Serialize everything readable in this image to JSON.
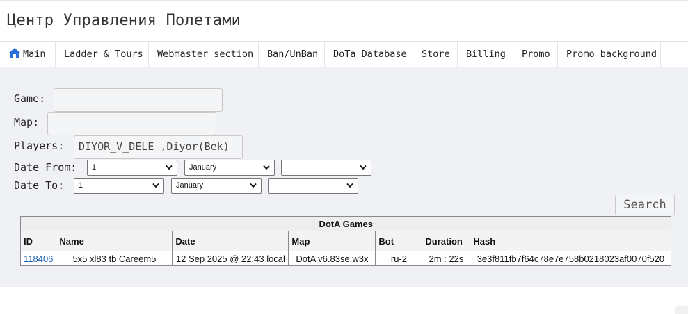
{
  "site": {
    "title": "Центр Управления Полетами"
  },
  "nav": {
    "items": [
      {
        "label": "Main"
      },
      {
        "label": "Ladder & Tours"
      },
      {
        "label": "Webmaster section"
      },
      {
        "label": "Ban/UnBan"
      },
      {
        "label": "DoTa Database"
      },
      {
        "label": "Store"
      },
      {
        "label": "Billing"
      },
      {
        "label": "Promo"
      },
      {
        "label": "Promo background"
      }
    ],
    "home_icon": "home-icon",
    "accent": "#2a6ed8"
  },
  "form": {
    "game": {
      "label": "Game:",
      "value": ""
    },
    "map": {
      "label": "Map:",
      "value": ""
    },
    "players": {
      "label": "Players:",
      "value": "DIYOR_V_DELE ,Diyor(Bek)"
    },
    "date_from": {
      "label": "Date From:",
      "day": "1",
      "month": "January",
      "year": ""
    },
    "date_to": {
      "label": "Date To:",
      "day": "1",
      "month": "January",
      "year": ""
    },
    "search_label": "Search"
  },
  "table": {
    "caption": "DotA Games",
    "columns": [
      "ID",
      "Name",
      "Date",
      "Map",
      "Bot",
      "Duration",
      "Hash"
    ],
    "rows": [
      {
        "id": "118406",
        "name": "5x5 xl83 tb Careem5",
        "date": "12 Sep 2025 @ 22:43 local",
        "map": "DotA v6.83se.w3x",
        "bot": "ru-2",
        "duration": "2m : 22s",
        "hash": "3e3f811fb7f64c78e7e758b0218023af0070f520"
      }
    ],
    "link_color": "#1a5fb4"
  }
}
